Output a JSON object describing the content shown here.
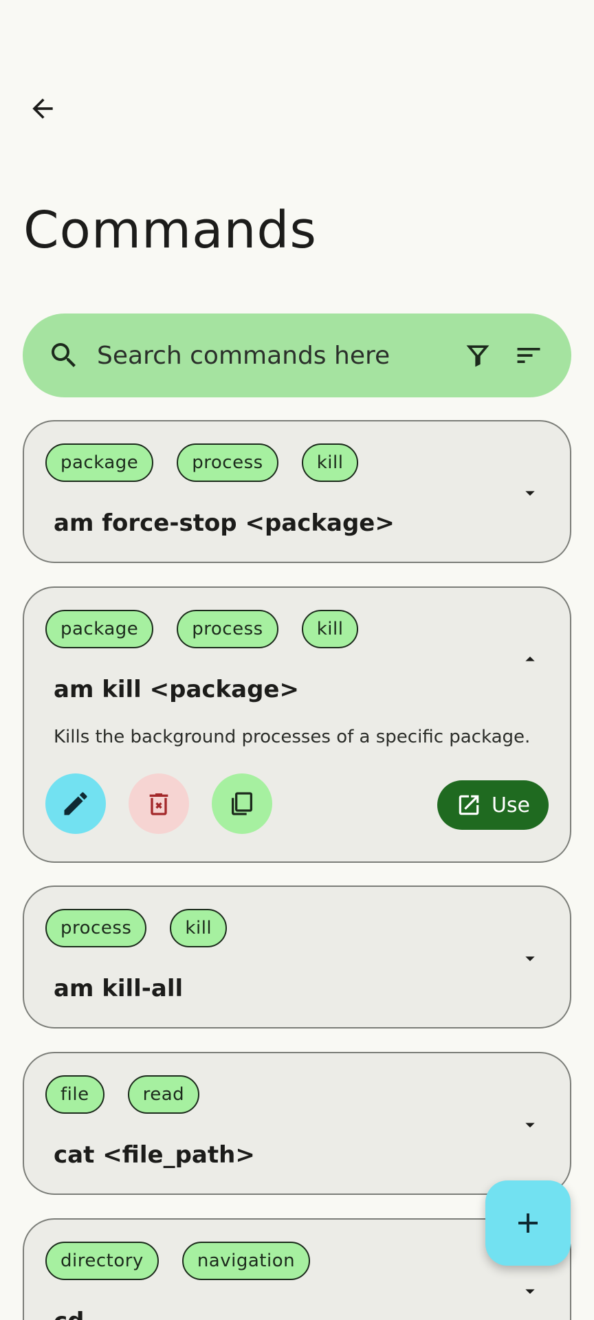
{
  "header": {
    "back_icon": "arrow-back-icon",
    "title": "Commands"
  },
  "search": {
    "placeholder": "Search commands here",
    "search_icon": "search-icon",
    "filter_icon": "filter-icon",
    "sort_icon": "sort-icon"
  },
  "colors": {
    "background": "#f9f9f4",
    "search_bar": "#a5e3a0",
    "chip": "#a6f0a0",
    "card": "#ececE7",
    "edit": "#72e1f1",
    "delete": "#f6d4d2",
    "copy": "#a6f0a0",
    "use": "#1f6a20",
    "fab": "#72e1f1"
  },
  "commands": [
    {
      "tags": [
        "package",
        "process",
        "kill"
      ],
      "command": "am force-stop <package>",
      "expanded": false
    },
    {
      "tags": [
        "package",
        "process",
        "kill"
      ],
      "command": "am kill <package>",
      "description": "Kills the background processes of a specific package.",
      "expanded": true,
      "use_label": "Use"
    },
    {
      "tags": [
        "process",
        "kill"
      ],
      "command": "am kill-all",
      "expanded": false
    },
    {
      "tags": [
        "file",
        "read"
      ],
      "command": "cat <file_path>",
      "expanded": false
    },
    {
      "tags": [
        "directory",
        "navigation"
      ],
      "command": "cd -",
      "expanded": false
    }
  ],
  "fab": {
    "icon": "add-icon"
  }
}
